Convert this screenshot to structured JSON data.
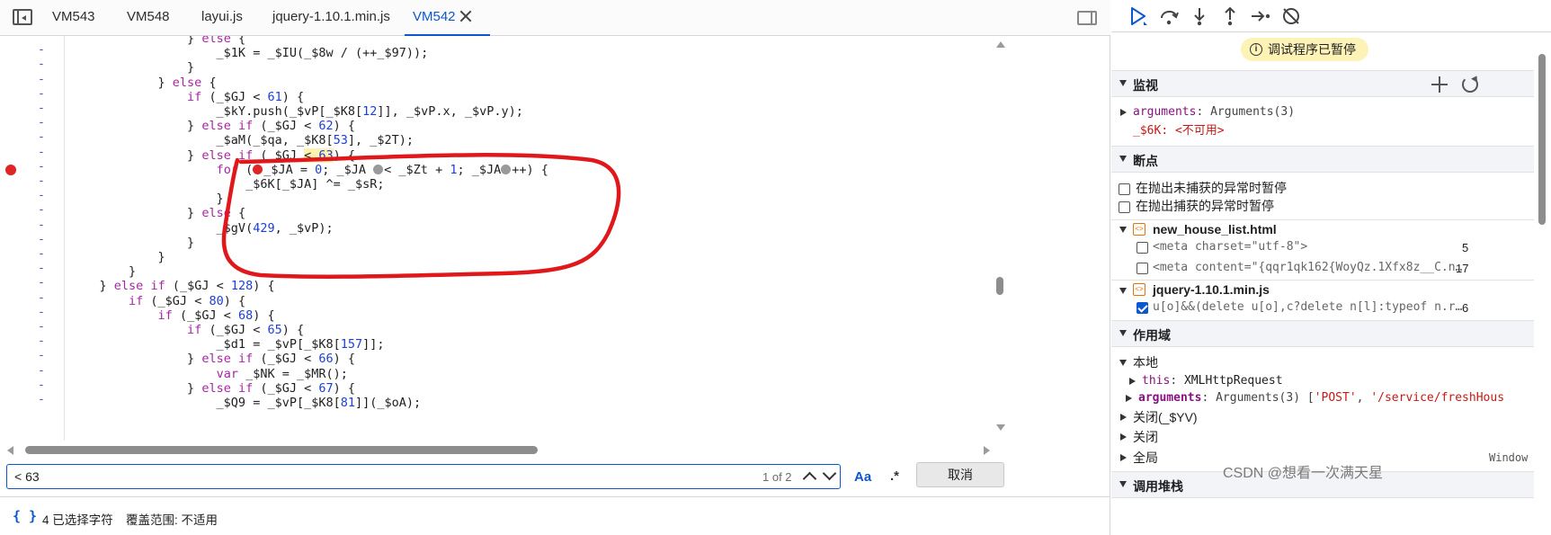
{
  "tabs": [
    {
      "label": "VM543"
    },
    {
      "label": "VM548"
    },
    {
      "label": "layui.js"
    },
    {
      "label": "jquery-1.10.1.min.js"
    },
    {
      "label": "VM542",
      "active": true
    }
  ],
  "code_lines": [
    "                } else {",
    "                    _$1K = _$IU(_$8w / (++_$97));",
    "                }",
    "            } else {",
    "                if (_$GJ < 61) {",
    "                    _$kY.push(_$vP[_$K8[12]], _$vP.x, _$vP.y);",
    "                } else if (_$GJ < 62) {",
    "                    _$aM(_$qa, _$K8[53], _$2T);",
    "                } else if (_$GJ < 63) {",
    "                    for (_$JA = 0; _$JA < _$Zt + 1; _$JA++) {",
    "                        _$6K[_$JA] ^= _$sR;",
    "                    }",
    "                } else {",
    "                    _$gV(429, _$vP);",
    "                }",
    "            }",
    "        }",
    "    } else if (_$GJ < 128) {",
    "        if (_$GJ < 80) {",
    "            if (_$GJ < 68) {",
    "                if (_$GJ < 65) {",
    "                    _$d1 = _$vP[_$K8[157]];",
    "                } else if (_$GJ < 66) {",
    "                    var _$NK = _$MR();",
    "                } else if (_$GJ < 67) {",
    "                    _$Q9 = _$vP[_$K8[81]](_$oA);"
  ],
  "gutter_dash": "-",
  "search": {
    "value": "< 63",
    "count": "1 of 2",
    "case_label": "Aa",
    "regex_label": ".*",
    "cancel_label": "取消"
  },
  "status": {
    "pretty_print": "{ }",
    "selected": "4 已选择字符",
    "coverage": "覆盖范围: 不适用"
  },
  "debugger": {
    "paused_label": "调试程序已暂停",
    "paused_icon": "i",
    "watch": {
      "title": "监视",
      "items": [
        {
          "name": "arguments",
          "sep": ": ",
          "value": "Arguments(3)"
        },
        {
          "name": "_$6K",
          "sep": ": ",
          "value": "<不可用>"
        }
      ]
    },
    "breakpoints": {
      "title": "断点",
      "options": [
        "在抛出未捕获的异常时暂停",
        "在抛出捕获的异常时暂停"
      ],
      "files": [
        {
          "name": "new_house_list.html",
          "icon": "<>",
          "entries": [
            {
              "code": "<meta charset=\"utf-8\">",
              "line": "5",
              "checked": false
            },
            {
              "code": "<meta content=\"{qqr1qk162{WoyQz.1Xfx8z__C.n…",
              "line": "17",
              "checked": false
            }
          ]
        },
        {
          "name": "jquery-1.10.1.min.js",
          "icon": "<>",
          "entries": [
            {
              "code": "u[o]&&(delete u[o],c?delete n[l]:typeof n.r…",
              "line": "6",
              "checked": true
            }
          ]
        }
      ]
    },
    "scope": {
      "title": "作用域",
      "local_title": "本地",
      "local_items": [
        {
          "name": "this",
          "sep": ": ",
          "value": "XMLHttpRequest"
        },
        {
          "name": "arguments",
          "sep": ": ",
          "value": "Arguments(3) [",
          "str1": "'POST'",
          "mid": ", ",
          "str2": "'/service/freshHous"
        }
      ],
      "closures": [
        "关闭(_$YV)",
        "关闭",
        "全局"
      ],
      "window_label": "Window"
    },
    "callstack_title": "调用堆栈"
  },
  "watermark": "CSDN @想看一次满天星",
  "colors": {
    "accent": "#0b57d0",
    "breakpoint": "#e02525",
    "annotation": "#e0181b",
    "paused_badge": "#fdf3b6"
  }
}
